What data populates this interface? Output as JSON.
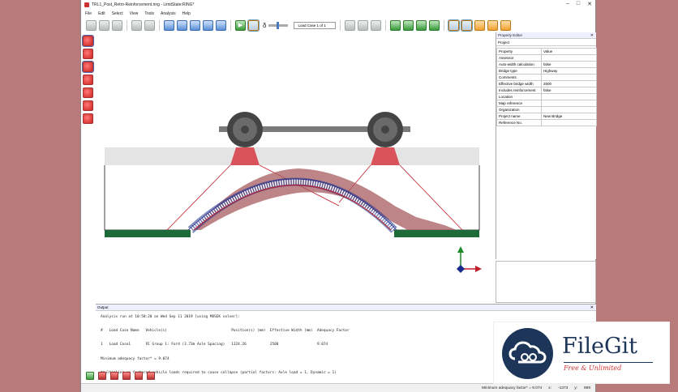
{
  "window": {
    "title": "TRL1_Post_Retro-Reinforcement.ring - LimitState:RING*",
    "controls": [
      "–",
      "□",
      "✕"
    ]
  },
  "menu": [
    "File",
    "Edit",
    "Select",
    "View",
    "Tools",
    "Analysis",
    "Help"
  ],
  "toolbar": {
    "delta_symbol": "δ",
    "load_case_value": "Load Case 1 of 1"
  },
  "property_editor": {
    "title": "Property Editor",
    "section": "Project",
    "header": {
      "property": "Property",
      "value": "Value"
    },
    "rows": [
      {
        "property": "Assessor",
        "value": ""
      },
      {
        "property": "Auto-width calculation",
        "value": "false"
      },
      {
        "property": "Bridge type",
        "value": "Highway"
      },
      {
        "property": "Comments",
        "value": ""
      },
      {
        "property": "Effective bridge width",
        "value": "2500"
      },
      {
        "property": "Includes reinforcement",
        "value": "false"
      },
      {
        "property": "Location",
        "value": ""
      },
      {
        "property": "Map reference",
        "value": ""
      },
      {
        "property": "Organization",
        "value": ""
      },
      {
        "property": "Project name",
        "value": "New Bridge"
      },
      {
        "property": "Reference No.",
        "value": ""
      }
    ]
  },
  "output": {
    "title": "Output",
    "text": "Analysis run at 10:58:20 on Wed Sep 11 2019 [using MOSEK solver]:\n\n#   Load Case Name   Vehicle(s)                              Position(s) (mm)  Effective Width (mm)  Adequacy Factor\n\n1   Load Case1       FE Group 1: Ford (3.73m Axle Spacing)   1324.26           2500                  9.074\n\nMinimum adequacy factor* = 9.074\n\n*multiplier on factored vehicle loads required to cause collapse (partial factors: Axle load = 1, Dynamic = 1)"
  },
  "status": {
    "adequacy": "Minimum adequacy factor* = 9.074",
    "x_label": "x:",
    "x_value": "-1373",
    "y_label": "y:",
    "y_value": "889"
  },
  "watermark": {
    "brand": "FileGit",
    "tagline": "Free & Unlimited"
  },
  "colors": {
    "background": "#b97a7c",
    "ground": "#1e6b3a",
    "load_spread": "#d9545a",
    "arch_stress": "#a85c60",
    "axis_x": "#c0202a",
    "axis_y": "#1e8a2a",
    "axis_z": "#1a2a8a",
    "logo": "#1d3559"
  }
}
